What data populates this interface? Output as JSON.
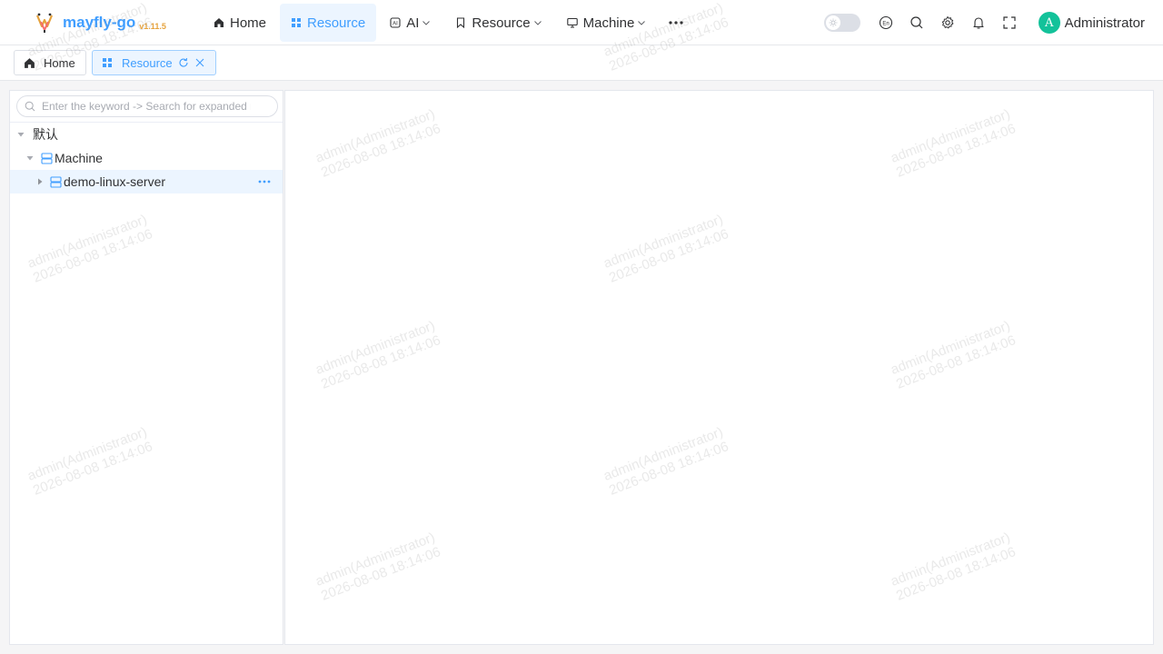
{
  "app": {
    "name": "mayfly-go",
    "version": "v1.11.5"
  },
  "topnav": {
    "items": [
      {
        "label": "Home",
        "icon": "home-icon"
      },
      {
        "label": "Resource",
        "icon": "grid-icon",
        "active": true
      },
      {
        "label": "AI",
        "icon": "ai-icon",
        "dropdown": true
      },
      {
        "label": "Resource",
        "icon": "bookmark-icon",
        "dropdown": true
      },
      {
        "label": "Machine",
        "icon": "monitor-icon",
        "dropdown": true
      }
    ],
    "more_icon": "more-horizontal-icon"
  },
  "toolbar": {
    "theme_toggle": "off",
    "icons": [
      "language-icon",
      "search-icon",
      "settings-icon",
      "bell-icon",
      "fullscreen-icon"
    ],
    "user": {
      "initial": "A",
      "name": "Administrator",
      "avatar_color": "#13c29a"
    }
  },
  "tags": [
    {
      "label": "Home",
      "icon": "home-icon"
    },
    {
      "label": "Resource",
      "icon": "grid-icon",
      "active": true
    }
  ],
  "tree": {
    "search_placeholder": "Enter the keyword -> Search for expanded nodes",
    "nodes": [
      {
        "label": "默认",
        "level": 0,
        "expanded": true
      },
      {
        "label": "Machine",
        "level": 1,
        "expanded": true,
        "icon": "server-icon"
      },
      {
        "label": "demo-linux-server",
        "level": 2,
        "expanded": false,
        "icon": "server-icon",
        "selected": true
      }
    ]
  },
  "watermark": {
    "line1": "admin(Administrator)",
    "line2": "2026-08-08 18:14:06"
  },
  "colors": {
    "primary": "#409eff",
    "version": "#e6a23c",
    "active_bg": "#ecf5ff"
  }
}
